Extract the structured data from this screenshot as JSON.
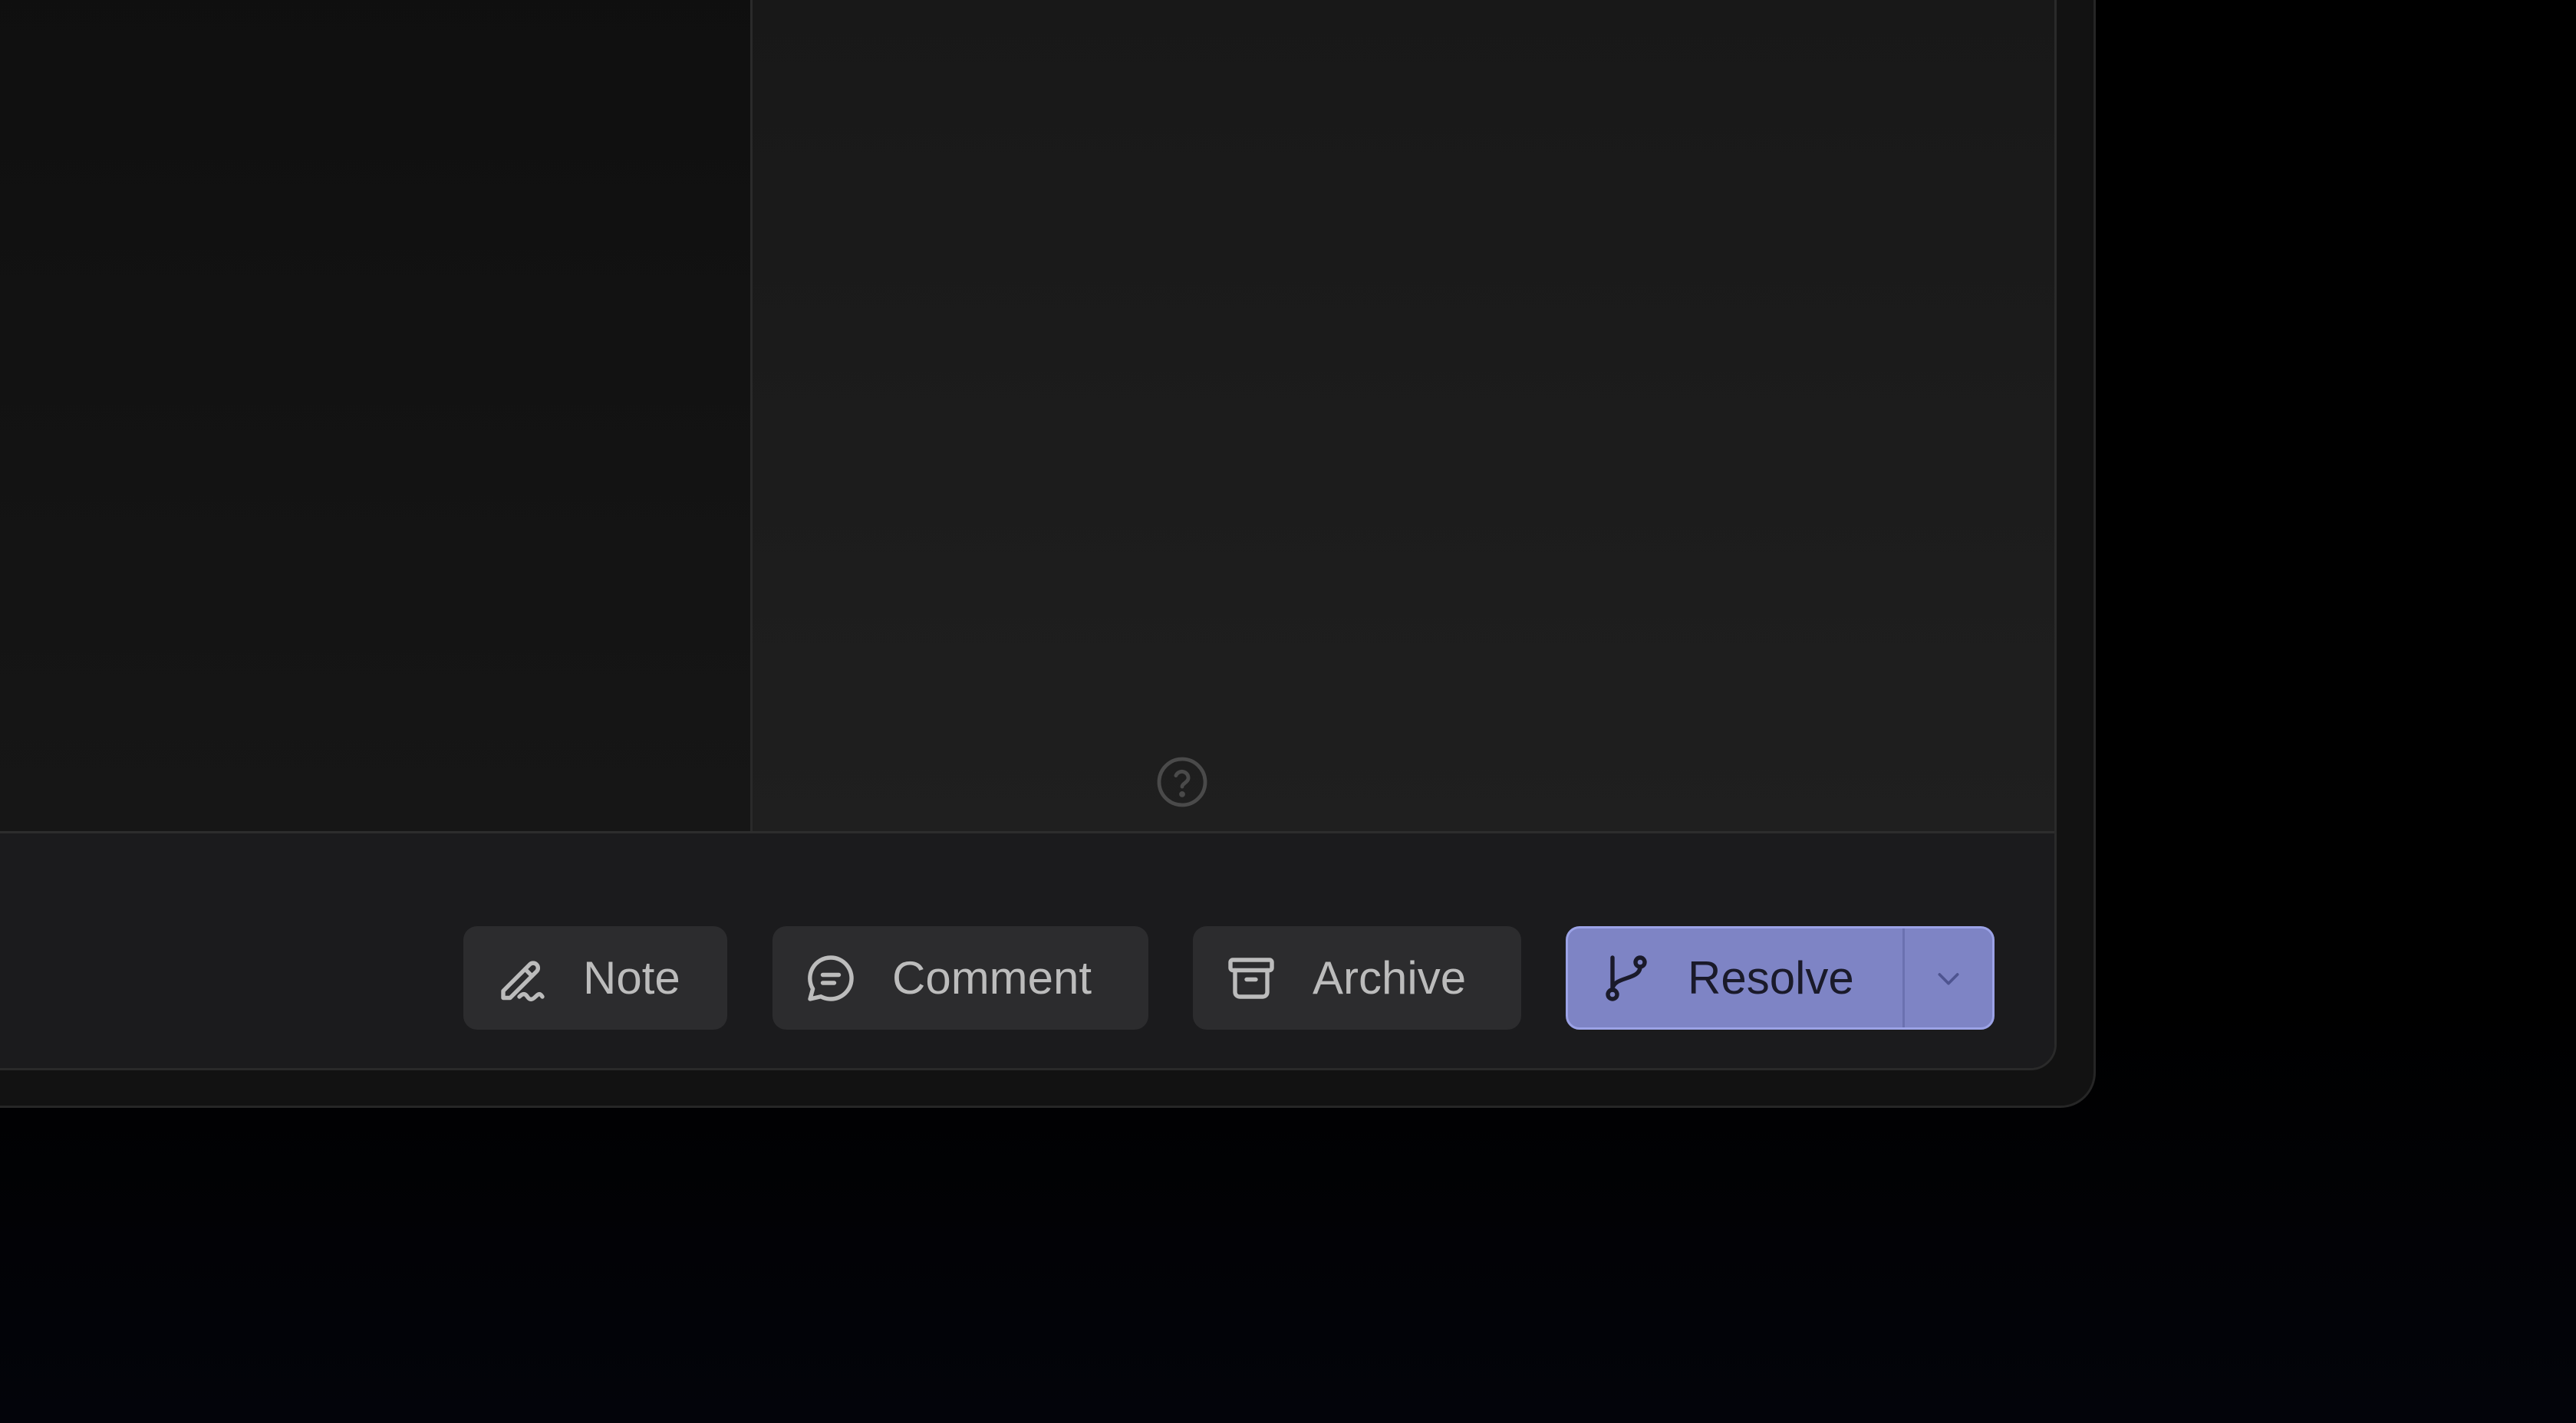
{
  "footer": {
    "buttons": {
      "note": {
        "label": "Note",
        "icon": "pen-signature-icon"
      },
      "comment": {
        "label": "Comment",
        "icon": "chat-bubble-icon"
      },
      "archive": {
        "label": "Archive",
        "icon": "archive-box-icon"
      },
      "resolve": {
        "label": "Resolve",
        "icon": "git-branch-icon",
        "dropdown_icon": "chevron-down-icon"
      }
    }
  },
  "help": {
    "icon": "question-circle-icon"
  },
  "colors": {
    "accent": "#7e84c5",
    "accent_border": "#9ba2e6",
    "button_secondary": "#2c2c2e",
    "panel": "#141414"
  }
}
